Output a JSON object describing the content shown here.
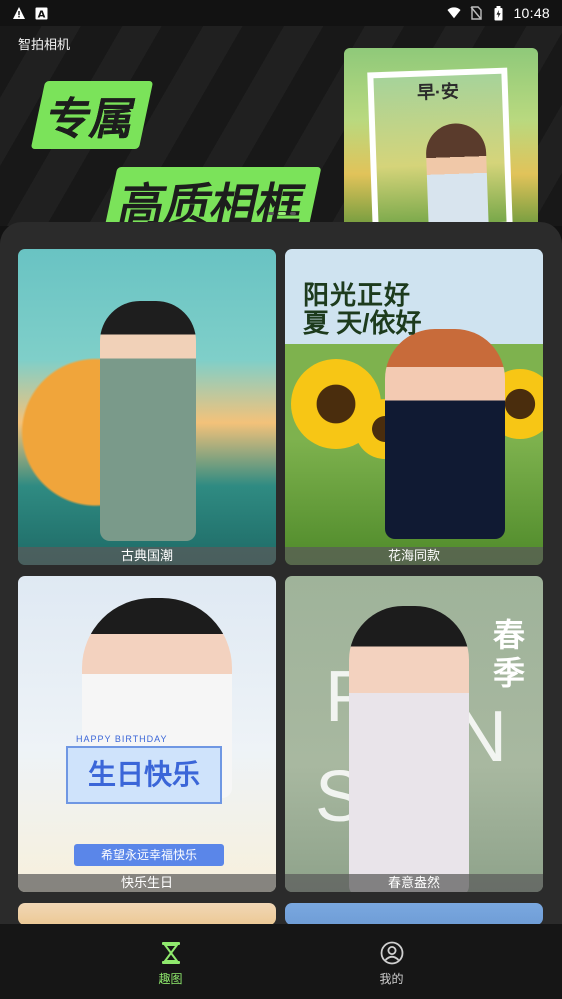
{
  "status_bar": {
    "time": "10:48",
    "icons_left": [
      "warning-icon",
      "font-a-icon"
    ],
    "icons_right": [
      "wifi-icon",
      "no-sim-icon",
      "battery-icon"
    ]
  },
  "banner": {
    "app_title": "智拍相机",
    "slogan_line1": "专属",
    "slogan_line2": "高质相框",
    "photo_caption": "早·安",
    "accent": "#7be35a"
  },
  "grid": {
    "cards": [
      {
        "label": "古典国潮"
      },
      {
        "label": "花海同款",
        "art_title_1": "阳光正好",
        "art_title_2": "夏 天/依好"
      },
      {
        "label": "快乐生日",
        "art_small": "HAPPY BIRTHDAY",
        "art_title": "生日快乐",
        "art_wish": "希望永远幸福快乐"
      },
      {
        "label": "春意盎然",
        "art_big_1": "P",
        "art_big_2": "N",
        "art_big_3": "S",
        "art_side": "春季"
      }
    ]
  },
  "bottom_nav": {
    "items": [
      {
        "label": "趣图",
        "icon": "hourglass-icon",
        "active": true
      },
      {
        "label": "我的",
        "icon": "profile-icon",
        "active": false
      }
    ],
    "active_color": "#8fe96d"
  }
}
